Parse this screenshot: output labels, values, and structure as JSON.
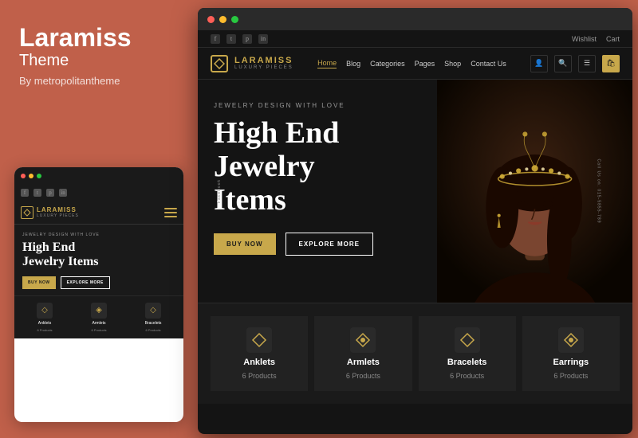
{
  "left_panel": {
    "brand_name": "Laramiss",
    "brand_subtitle": "Theme",
    "brand_by": "By metropolitantheme"
  },
  "desktop": {
    "titlebar": {
      "dots": [
        "red",
        "yellow",
        "green"
      ]
    },
    "social_bar": {
      "icons": [
        "f",
        "t",
        "p",
        "in"
      ],
      "right_links": [
        "Wishlist",
        "Cart"
      ]
    },
    "nav": {
      "logo_name": "LARAMISS",
      "logo_sub": "LUXURY PIECES",
      "links": [
        {
          "label": "Home",
          "active": true
        },
        {
          "label": "Blog",
          "active": false
        },
        {
          "label": "Categories",
          "active": false
        },
        {
          "label": "Pages",
          "active": false
        },
        {
          "label": "Shop",
          "active": false
        },
        {
          "label": "Contact Us",
          "active": false
        }
      ],
      "icons": [
        "user",
        "search",
        "menu",
        "cart"
      ]
    },
    "hero": {
      "tag": "JEWELRY DESIGN WITH LOVE",
      "title_line1": "High End",
      "title_line2": "Jewelry",
      "title_line3": "Items",
      "btn_primary": "BUY NOW",
      "btn_secondary": "EXPLORE MORE",
      "side_text": "Call Us on: 015-5855-789",
      "side_text2": "Facebook"
    },
    "categories": [
      {
        "name": "Anklets",
        "count": "6 Products",
        "icon": "◇"
      },
      {
        "name": "Armlets",
        "count": "6 Products",
        "icon": "◈"
      },
      {
        "name": "Bracelets",
        "count": "6 Products",
        "icon": "◇"
      },
      {
        "name": "Earrings",
        "count": "6 Products",
        "icon": "◈"
      }
    ]
  },
  "mobile": {
    "nav": {
      "logo_name": "LARAMISS",
      "logo_sub": "LUXURY PIECES"
    },
    "hero": {
      "tag": "JEWELRY DESIGN WITH LOVE",
      "title_line1": "High End",
      "title_line2": "Jewelry Items",
      "btn_primary": "BUY NOW",
      "btn_secondary": "EXPLORE MORE"
    },
    "categories": [
      {
        "name": "Anklets",
        "count": "6 Products",
        "icon": "◇"
      },
      {
        "name": "Armlets",
        "count": "6 Products",
        "icon": "◈"
      },
      {
        "name": "Bracelets",
        "count": "6 Products",
        "icon": "◇"
      }
    ]
  },
  "colors": {
    "gold": "#c8a84b",
    "dark": "#141414",
    "brand_red": "#c0604a"
  }
}
